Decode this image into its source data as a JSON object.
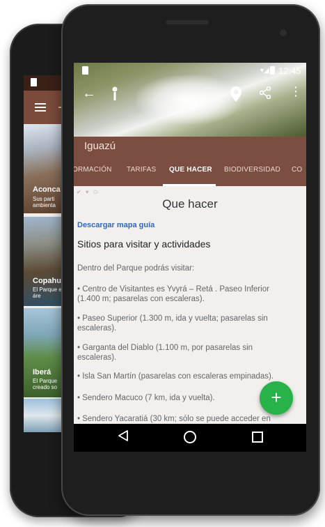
{
  "back_phone": {
    "cards": [
      {
        "title": "Aconca",
        "desc": "Sus parti ambienta"
      },
      {
        "title": "Copahu",
        "desc": "El Parque es un áre"
      },
      {
        "title": "Iberá",
        "desc": "El Parque creado so"
      }
    ]
  },
  "status": {
    "time": "12:45"
  },
  "park_name": "Iguazú",
  "tabs": [
    "ORMACIÓN",
    "TARIFAS",
    "QUE HACER",
    "BIODIVERSIDAD",
    "CO"
  ],
  "active_tab": "QUE HACER",
  "content": {
    "title": "Que hacer",
    "download_link": "Descargar mapa guía",
    "subheading": "Sitios para visitar y actividades",
    "paragraphs": [
      "Dentro del Parque podrás visitar:",
      "• Centro de Visitantes es Yvyrá – Retá . Paseo Inferior (1.400 m; pasarelas con escaleras).",
      "• Paseo Superior (1.300 m, ida y vuelta; pasarelas sin escaleras).",
      "• Garganta del Diablo (1.100 m, por pasarelas sin escaleras).",
      "• Isla San Martín (pasarelas con escaleras empinadas).",
      "• Sendero Macuco (7 km, ida y vuelta).",
      "• Sendero Yacaratiá (30 km; sólo se puede acceder en"
    ]
  },
  "fab_label": "+",
  "colors": {
    "brand": "#7b4e41",
    "fab": "#28b34a",
    "link": "#3367b5"
  }
}
